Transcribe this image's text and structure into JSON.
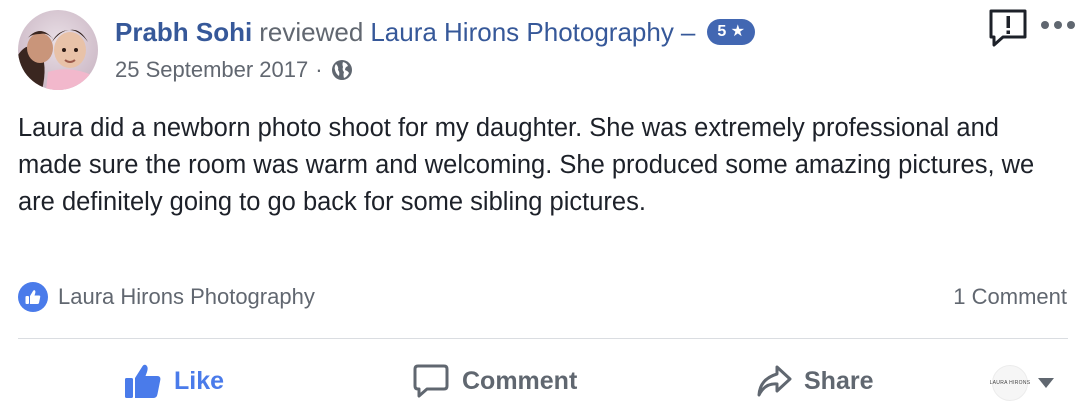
{
  "review": {
    "author": "Prabh Sohi",
    "verb": "reviewed",
    "page_name": "Laura Hirons Photography",
    "dash": "–",
    "rating_label": "5 ★",
    "date": "25 September 2017",
    "separator": "·",
    "privacy_icon": "globe-icon",
    "text": "Laura did a newborn photo shoot for my daughter. She was extremely professional and made sure the room was warm and welcoming. She produced some amazing pictures, we are definitely going to go back for some sibling pictures."
  },
  "reactions": {
    "icon": "like-reaction-icon",
    "liked_by": "Laura Hirons Photography",
    "comment_count": "1 Comment"
  },
  "actions": {
    "like": "Like",
    "comment": "Comment",
    "share": "Share"
  },
  "page_selector": {
    "avatar_text": "LAURA HIRONS"
  },
  "colors": {
    "link": "#365899",
    "accent": "#4a7bea",
    "muted": "#616770",
    "badge": "#4267b2"
  }
}
